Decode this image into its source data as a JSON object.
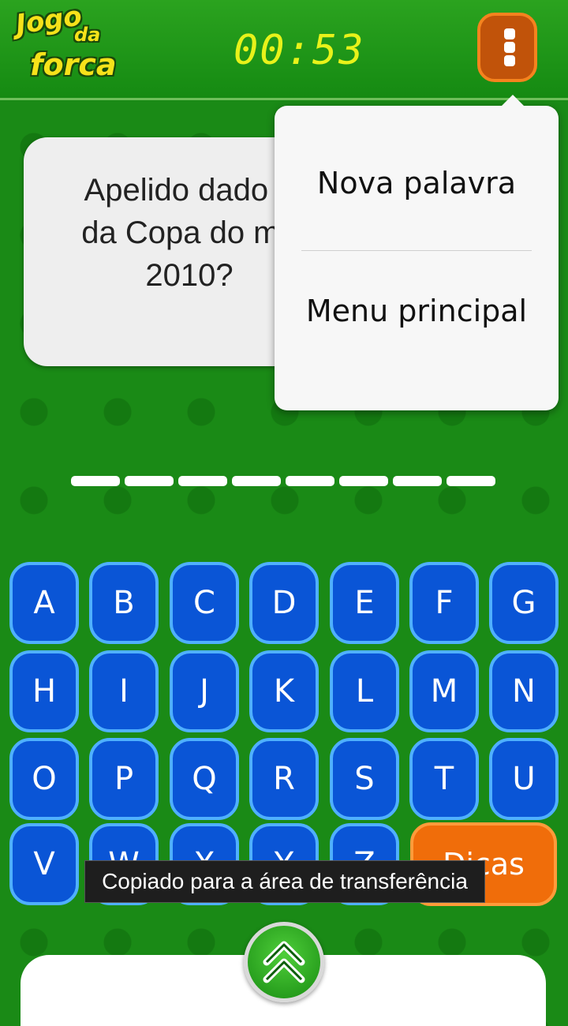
{
  "header": {
    "logo_lines": [
      "Jogo",
      "da",
      "forca"
    ],
    "timer": "00:53",
    "menu_icon": "overflow-menu-icon"
  },
  "question": {
    "text_lines": [
      "Apelido dado a",
      "da Copa do mu",
      "2010?"
    ]
  },
  "dropdown": {
    "items": [
      {
        "label": "Nova palavra"
      },
      {
        "label": "Menu principal"
      }
    ]
  },
  "word": {
    "blank_count": 8
  },
  "keyboard": {
    "rows": [
      [
        "A",
        "B",
        "C",
        "D",
        "E",
        "F",
        "G"
      ],
      [
        "H",
        "I",
        "J",
        "K",
        "L",
        "M",
        "N"
      ],
      [
        "O",
        "P",
        "Q",
        "R",
        "S",
        "T",
        "U"
      ],
      [
        "V",
        "W",
        "X",
        "Y",
        "Z"
      ]
    ],
    "hint_label": "Dicas"
  },
  "toast": {
    "text": "Copiado para a área de transferência"
  },
  "bottom": {
    "expand_icon": "double-chevron-up-icon"
  },
  "colors": {
    "background": "#1a8a16",
    "key": "#0a55d6",
    "hint": "#f06d0a",
    "timer": "#e8f21a"
  }
}
